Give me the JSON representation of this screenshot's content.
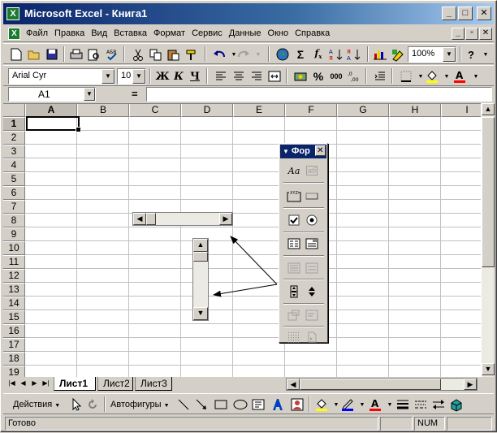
{
  "window": {
    "title": "Microsoft Excel - Книга1",
    "minimize": "_",
    "maximize": "□",
    "close": "✕"
  },
  "menu": {
    "items": [
      "Файл",
      "Правка",
      "Вид",
      "Вставка",
      "Формат",
      "Сервис",
      "Данные",
      "Окно",
      "Справка"
    ],
    "doc_minimize": "_",
    "doc_restore": "▫",
    "doc_close": "✕"
  },
  "standard_toolbar": {
    "zoom": "100%",
    "help": "?"
  },
  "formatting_toolbar": {
    "font_name": "Arial Cyr",
    "font_size": "10",
    "bold": "Ж",
    "italic": "К",
    "underline": "Ч",
    "percent": "%",
    "thousands": "000"
  },
  "formula_bar": {
    "name_box": "A1",
    "equals": "=",
    "formula": ""
  },
  "grid": {
    "columns": [
      "A",
      "B",
      "C",
      "D",
      "E",
      "F",
      "G",
      "H",
      "I"
    ],
    "rows": [
      "1",
      "2",
      "3",
      "4",
      "5",
      "6",
      "7",
      "8",
      "9",
      "10",
      "11",
      "12",
      "13",
      "14",
      "15",
      "16",
      "17",
      "18",
      "19"
    ],
    "active_cell": "A1"
  },
  "forms_toolbar": {
    "title": "Фор",
    "close": "✕",
    "label_icon": "Аа",
    "edit_icon": "аб",
    "group_icon": "XYZ"
  },
  "sheet_tabs": {
    "tabs": [
      "Лист1",
      "Лист2",
      "Лист3"
    ],
    "active": "Лист1"
  },
  "drawing_toolbar": {
    "actions": "Действия",
    "autoshapes": "Автофигуры"
  },
  "status_bar": {
    "text": "Готово",
    "num": "NUM"
  },
  "colors": {
    "title_bar": "#0a246a",
    "fill_color": "#ffff00",
    "font_color": "#ff0000",
    "line_color": "#0000ff"
  }
}
